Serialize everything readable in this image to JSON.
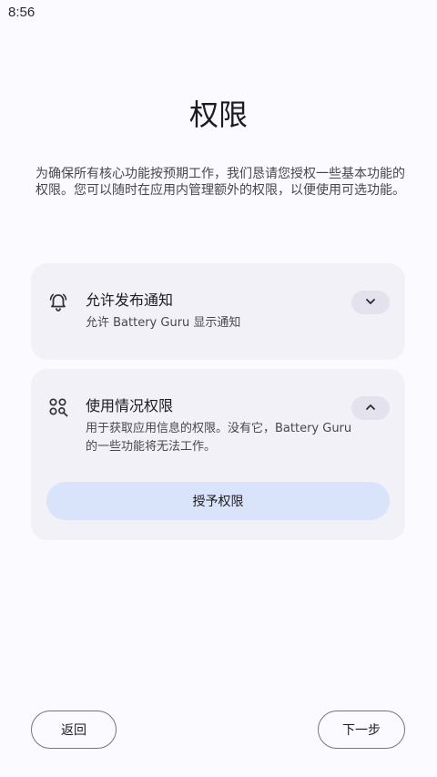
{
  "status_bar": {
    "time": "8:56"
  },
  "page": {
    "title": "权限",
    "intro": "为确保所有核心功能按预期工作，我们恳请您授权一些基本功能的权限。您可以随时在应用内管理额外的权限，以便使用可选功能。"
  },
  "permissions": [
    {
      "icon": "bell-icon",
      "title": "允许发布通知",
      "description": "允许 Battery Guru 显示通知",
      "expanded": false
    },
    {
      "icon": "usage-stats-icon",
      "title": "使用情况权限",
      "description": "用于获取应用信息的权限。没有它，Battery Guru 的一些功能将无法工作。",
      "expanded": true,
      "action_label": "授予权限"
    }
  ],
  "footer": {
    "back_label": "返回",
    "next_label": "下一步"
  },
  "colors": {
    "background": "#fbfafe",
    "card": "#f2f1f8",
    "chip": "#e4e2ec",
    "primary_button": "#d9e3fa"
  }
}
